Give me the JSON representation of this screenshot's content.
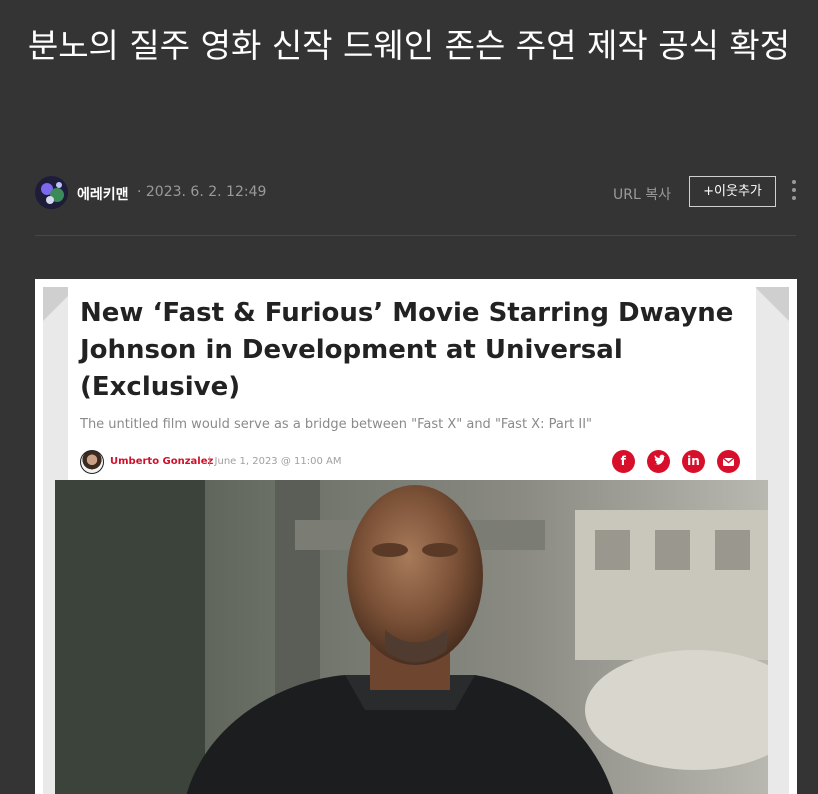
{
  "post": {
    "title": "분노의 질주 영화 신작 드웨인 존슨 주연 제작 공식 확정"
  },
  "meta": {
    "author": "에레키맨",
    "date": "· 2023. 6. 2. 12:49",
    "url_copy": "URL 복사",
    "add_neighbor": "+이웃추가"
  },
  "article": {
    "headline": "New ‘Fast & Furious’ Movie Starring Dwayne Johnson in Development at Universal (Exclusive)",
    "subhead": "The untitled film would serve as a bridge between \"Fast X\" and \"Fast X: Part II\"",
    "byline_author": "Umberto Gonzalez",
    "byline_date": "| June 1, 2023 @ 11:00 AM",
    "share_icons": [
      "facebook-icon",
      "twitter-icon",
      "linkedin-icon",
      "email-icon"
    ]
  },
  "colors": {
    "background": "#343434",
    "accent_red": "#d80f2a"
  }
}
